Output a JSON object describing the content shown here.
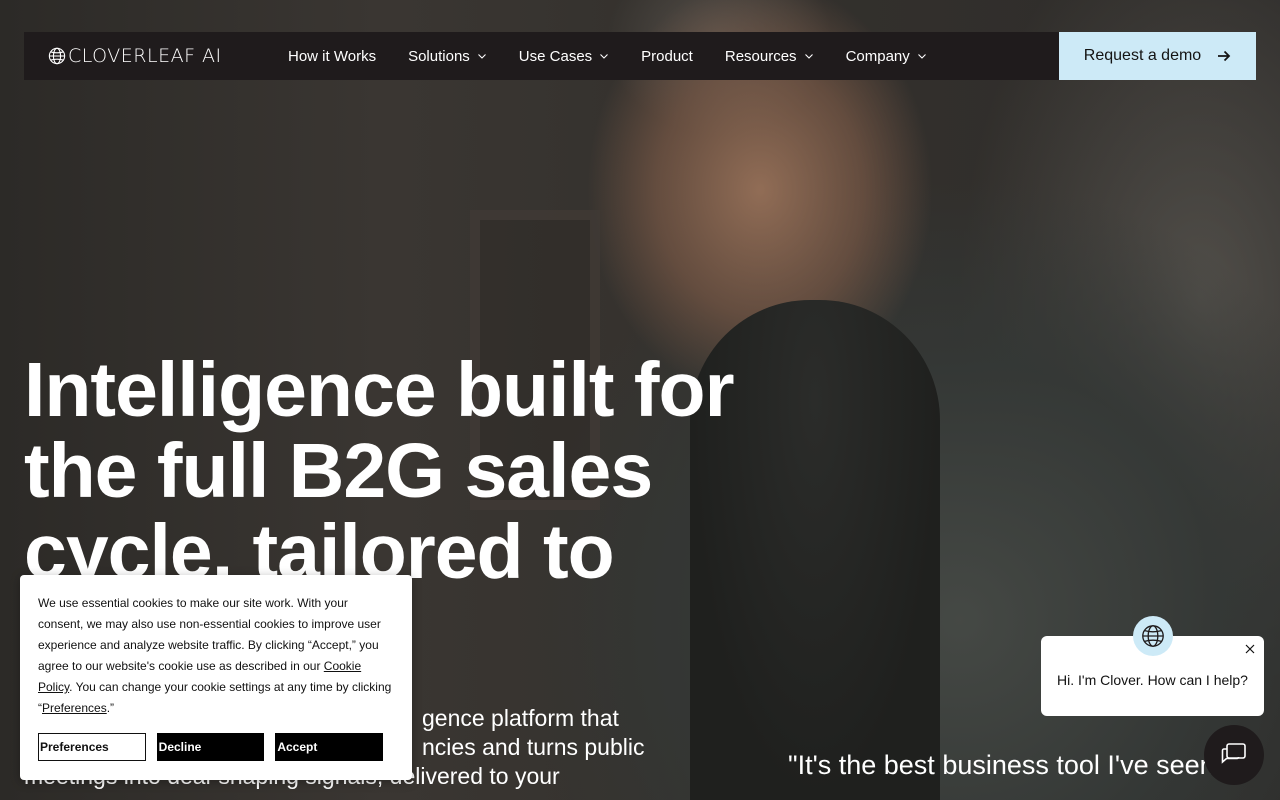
{
  "brand": {
    "logo_text": "CLOVERLEAF AI"
  },
  "nav": {
    "items": [
      {
        "label": "How it Works",
        "dropdown": false
      },
      {
        "label": "Solutions",
        "dropdown": true
      },
      {
        "label": "Use Cases",
        "dropdown": true
      },
      {
        "label": "Product",
        "dropdown": false
      },
      {
        "label": "Resources",
        "dropdown": true
      },
      {
        "label": "Company",
        "dropdown": true
      }
    ],
    "cta_label": "Request a demo"
  },
  "hero": {
    "headline_line1": "Intelligence built for",
    "headline_line2": "the full B2G sales",
    "headline_line3": "cycle, tailored to your",
    "sub_line1": "gence platform that",
    "sub_line2": "ncies and turns public",
    "sub_line3": "meetings into deal-shaping signals, delivered to your",
    "quote": "\"It's the best business tool I've seen"
  },
  "cookie_banner": {
    "text_part1": "We use essential cookies to make our site work. With your consent, we may also use non-essential cookies to improve user experience and analyze website traffic. By clicking “Accept,” you agree to our website's cookie use as described in our ",
    "cookie_policy_link": "Cookie Policy",
    "text_part2": ". You can change your cookie settings at any time by clicking “",
    "preferences_link": "Preferences",
    "text_part3": ".”",
    "buttons": {
      "preferences": "Preferences",
      "decline": "Decline",
      "accept": "Accept"
    }
  },
  "chat": {
    "message": "Hi. I'm Clover. How can I help?"
  },
  "colors": {
    "nav_bg": "#1f1b1c",
    "cta_bg": "#cdeaf7",
    "cookie_button_dark": "#000000"
  },
  "icons": {
    "logo": "globe-icon",
    "nav_dropdown": "chevron-down-icon",
    "cta": "arrow-right-icon",
    "chat_avatar": "globe-icon",
    "chat_close": "close-icon",
    "chat_launcher": "chat-bubble-icon"
  }
}
